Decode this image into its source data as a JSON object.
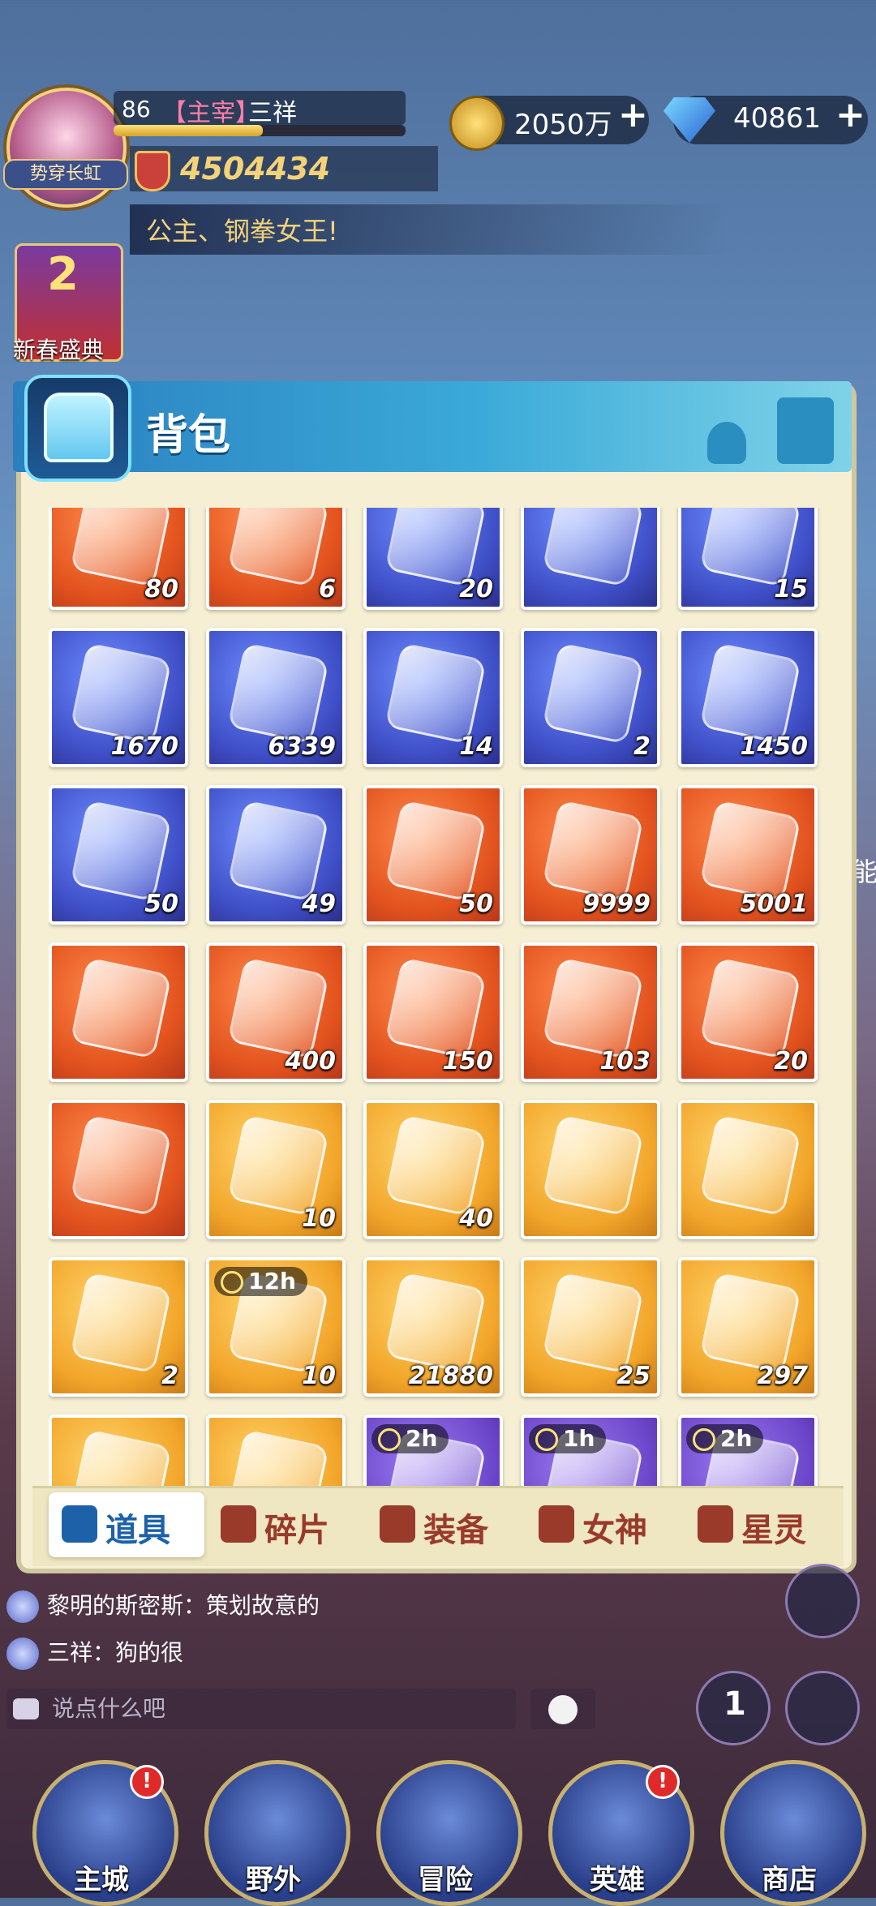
{
  "player": {
    "level": "86",
    "rank": "【主宰】",
    "name": "三祥",
    "power": "4504434",
    "avatar_tag": "势穿长虹",
    "xp_fraction": 0.51
  },
  "resources": {
    "gold": "2050万",
    "diamonds": "40861",
    "plus": "+"
  },
  "marquee": "公主、钢拳女王!",
  "event": {
    "label": "新春盛典",
    "badge_number": "2"
  },
  "panel": {
    "title": "背包"
  },
  "items": [
    {
      "count": "80",
      "rarity": "orange"
    },
    {
      "count": "6",
      "rarity": "orange"
    },
    {
      "count": "20",
      "rarity": "purple"
    },
    {
      "count": "",
      "rarity": "purple"
    },
    {
      "count": "15",
      "rarity": "purple"
    },
    {
      "count": "1670",
      "rarity": "purple"
    },
    {
      "count": "6339",
      "rarity": "purple"
    },
    {
      "count": "14",
      "rarity": "purple"
    },
    {
      "count": "2",
      "rarity": "purple"
    },
    {
      "count": "1450",
      "rarity": "purple"
    },
    {
      "count": "50",
      "rarity": "purple"
    },
    {
      "count": "49",
      "rarity": "purple"
    },
    {
      "count": "50",
      "rarity": "orange"
    },
    {
      "count": "9999",
      "rarity": "orange"
    },
    {
      "count": "5001",
      "rarity": "orange"
    },
    {
      "count": "",
      "rarity": "orange"
    },
    {
      "count": "400",
      "rarity": "orange"
    },
    {
      "count": "150",
      "rarity": "orange"
    },
    {
      "count": "103",
      "rarity": "orange"
    },
    {
      "count": "20",
      "rarity": "orange"
    },
    {
      "count": "",
      "rarity": "orange"
    },
    {
      "count": "10",
      "rarity": "gold"
    },
    {
      "count": "40",
      "rarity": "gold"
    },
    {
      "count": "",
      "rarity": "gold"
    },
    {
      "count": "",
      "rarity": "gold"
    },
    {
      "count": "2",
      "rarity": "gold"
    },
    {
      "count": "10",
      "rarity": "gold",
      "timer": "12h"
    },
    {
      "count": "21880",
      "rarity": "gold"
    },
    {
      "count": "25",
      "rarity": "gold"
    },
    {
      "count": "297",
      "rarity": "gold"
    },
    {
      "count": "",
      "rarity": "gold"
    },
    {
      "count": "",
      "rarity": "gold"
    },
    {
      "count": "",
      "rarity": "violet",
      "timer": "2h"
    },
    {
      "count": "",
      "rarity": "violet",
      "timer": "1h"
    },
    {
      "count": "",
      "rarity": "violet",
      "timer": "2h"
    }
  ],
  "tabs": [
    {
      "label": "道具",
      "active": true
    },
    {
      "label": "碎片",
      "active": false
    },
    {
      "label": "装备",
      "active": false
    },
    {
      "label": "女神",
      "active": false
    },
    {
      "label": "星灵",
      "active": false
    }
  ],
  "chat": {
    "lines": [
      {
        "text": "黎明的斯密斯：策划故意的"
      },
      {
        "text": "三祥：狗的很"
      }
    ],
    "placeholder": "说点什么吧"
  },
  "side_text": "能",
  "leaderboard_badge": "1",
  "nav": [
    {
      "label": "主城",
      "badge": "!"
    },
    {
      "label": "野外",
      "badge": ""
    },
    {
      "label": "冒险",
      "badge": ""
    },
    {
      "label": "英雄",
      "badge": "!"
    },
    {
      "label": "商店",
      "badge": ""
    }
  ],
  "colors": {
    "panel_bg": "#f6efd3",
    "header": "#3aa9d8",
    "tab_active_text": "#1d62a8",
    "tab_text": "#9a3a2a"
  }
}
